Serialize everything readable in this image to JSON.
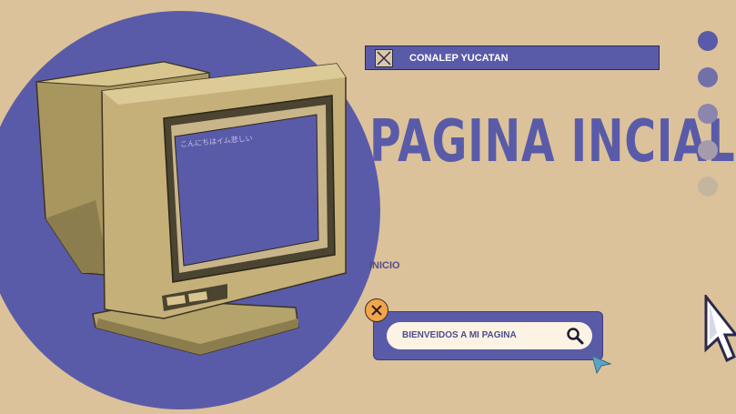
{
  "monitor": {
    "screen_text": "こんにちはイム悲しい"
  },
  "title_bar": {
    "label": "CONALEP YUCATAN"
  },
  "headline": "PAGINA INCIAL",
  "nav": {
    "inicio": "INICIO"
  },
  "search": {
    "text": "BIENVEIDOS A MI PAGINA"
  },
  "colors": {
    "background": "#dcc29a",
    "accent": "#5a5ba8",
    "dots": [
      "#5a5ba8",
      "#7170a9",
      "#8c85ae",
      "#a69bab",
      "#c4b59f"
    ],
    "close_button": "#f2a44d"
  },
  "icons": [
    "close-icon",
    "search-icon",
    "window-x-icon",
    "pointer-icon",
    "cursor-icon"
  ]
}
